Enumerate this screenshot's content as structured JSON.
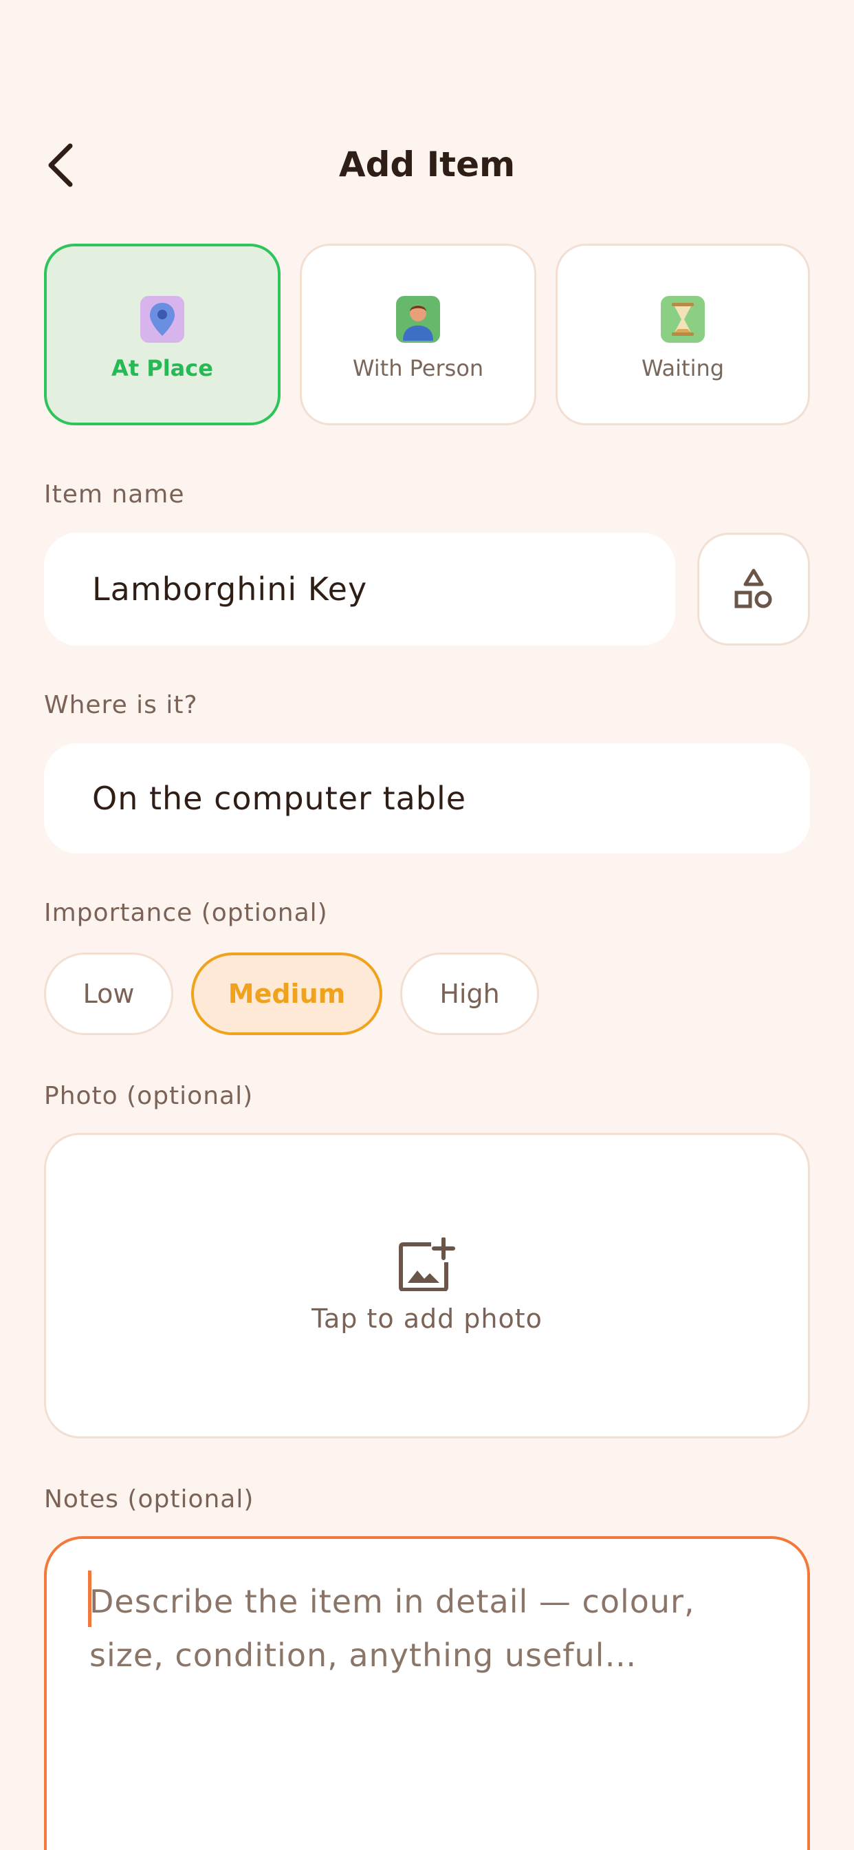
{
  "header": {
    "title": "Add Item"
  },
  "types": [
    {
      "label": "At Place",
      "icon": "location-pin-icon",
      "active": true
    },
    {
      "label": "With Person",
      "icon": "person-icon",
      "active": false
    },
    {
      "label": "Waiting",
      "icon": "hourglass-icon",
      "active": false
    }
  ],
  "item_name": {
    "label": "Item name",
    "value": "Lamborghini Key"
  },
  "location": {
    "label": "Where is it?",
    "value": "On the computer table"
  },
  "importance": {
    "label": "Importance (optional)",
    "options": [
      "Low",
      "Medium",
      "High"
    ],
    "selected": "Medium"
  },
  "photo": {
    "label": "Photo (optional)",
    "prompt": "Tap to add photo"
  },
  "notes": {
    "label": "Notes (optional)",
    "placeholder": "Describe the item in detail — colour, size, condition, anything useful…"
  },
  "colors": {
    "background": "#fdf4ef",
    "active_green": "#2ec45b",
    "selected_orange": "#f0a21d",
    "focus_orange": "#f2793b"
  }
}
